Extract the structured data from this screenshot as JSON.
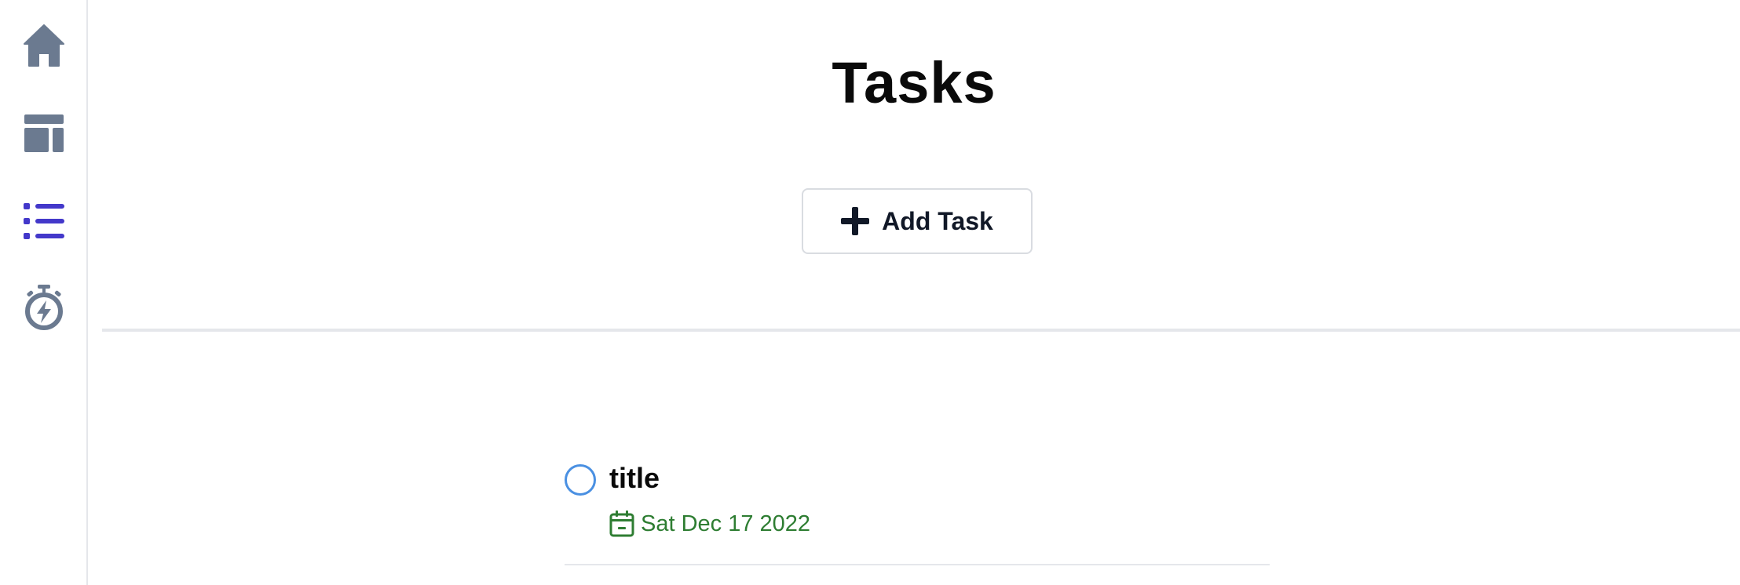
{
  "sidebar": {
    "items": [
      {
        "icon": "home-icon",
        "color": "#6b7a90",
        "active": false
      },
      {
        "icon": "layout-icon",
        "color": "#6b7a90",
        "active": false
      },
      {
        "icon": "list-icon",
        "color": "#4338ca",
        "active": true
      },
      {
        "icon": "stopwatch-bolt-icon",
        "color": "#6b7a90",
        "active": false
      }
    ]
  },
  "main": {
    "title": "Tasks",
    "add_task_label": "Add Task"
  },
  "tasks": [
    {
      "title": "title",
      "due_date": "Sat Dec 17 2022",
      "completed": false,
      "date_color": "#2e7d32",
      "checkbox_color": "#4a90e2"
    }
  ]
}
